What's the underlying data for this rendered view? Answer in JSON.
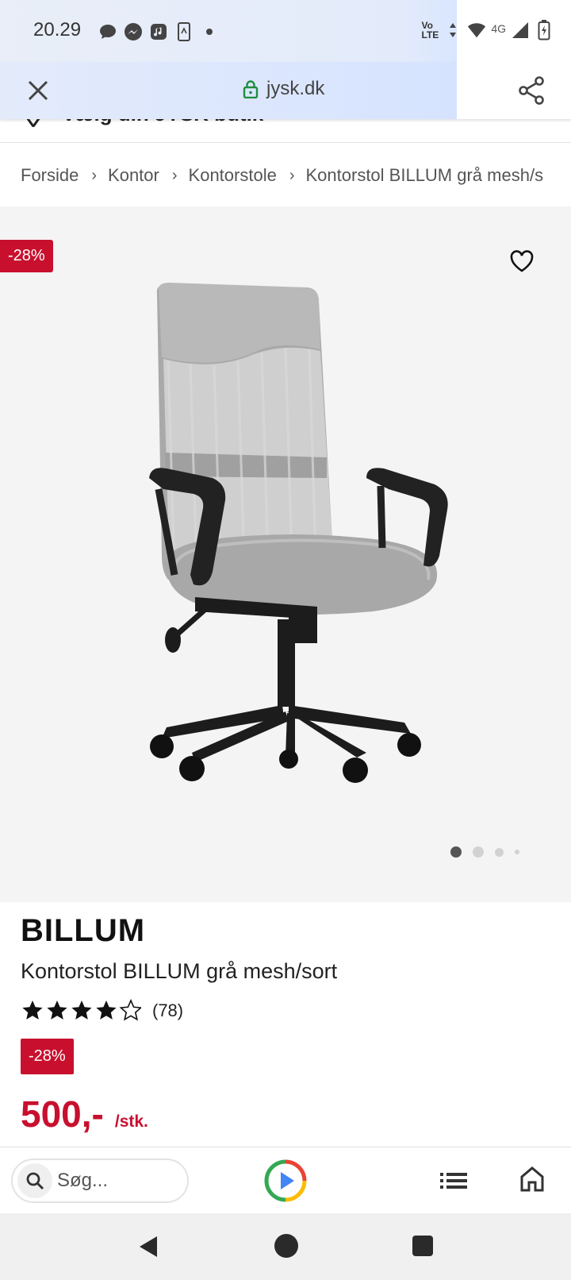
{
  "status_bar": {
    "time": "20.29",
    "volte_top": "Vo",
    "volte_bottom": "LTE",
    "network": "4G"
  },
  "browser": {
    "url": "jysk.dk"
  },
  "store_selector": {
    "label": "Vælg din JYSK butik"
  },
  "breadcrumb": {
    "items": [
      "Forside",
      "Kontor",
      "Kontorstole",
      "Kontorstol BILLUM grå mesh/s"
    ]
  },
  "gallery": {
    "discount_badge": "-28%",
    "total_images": 4,
    "active_index": 0
  },
  "product": {
    "brand": "BILLUM",
    "name": "Kontorstol BILLUM grå mesh/sort",
    "rating": 4,
    "rating_max": 5,
    "rating_count": "(78)",
    "discount_badge": "-28%",
    "price": "500,-",
    "price_unit": "/stk."
  },
  "app_bar": {
    "search_placeholder": "Søg..."
  },
  "colors": {
    "brand_red": "#c8102e",
    "lock_green": "#1e8e3e"
  }
}
